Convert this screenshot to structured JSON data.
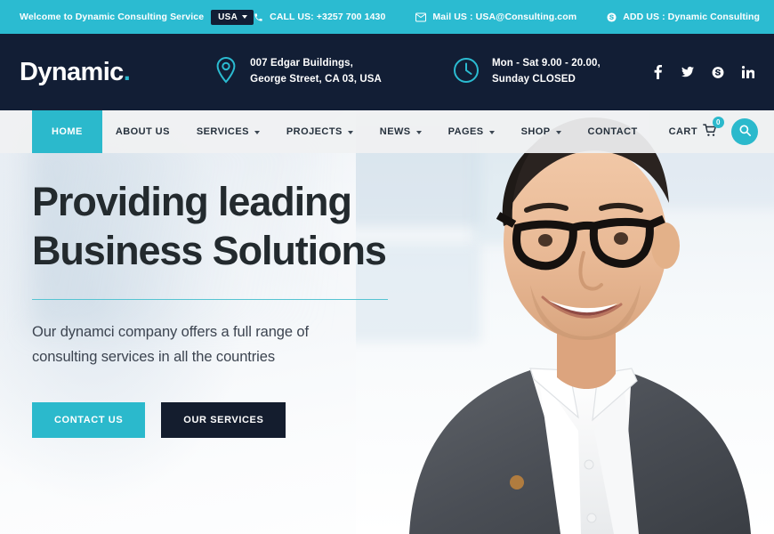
{
  "topbar": {
    "welcome": "Welcome to Dynamic Consulting Service",
    "country": "USA",
    "call": "CALL US: +3257 700 1430",
    "mail": "Mail US : USA@Consulting.com",
    "address": "ADD US : Dynamic Consulting",
    "icons": {
      "phone": "phone-icon",
      "envelope": "envelope-icon",
      "skype": "skype-icon",
      "caret": "chevron-down-icon"
    },
    "bg_color": "#2bbbd1"
  },
  "header": {
    "logo_text": "Dynamic",
    "logo_dot": ".",
    "address_line1": "007 Edgar Buildings,",
    "address_line2": "George Street, CA 03, USA",
    "hours_line1": "Mon - Sat 9.00 - 20.00,",
    "hours_line2": "Sunday CLOSED",
    "bg_color": "#121e35",
    "social": [
      {
        "name": "facebook",
        "label": "f"
      },
      {
        "name": "twitter",
        "label": "t"
      },
      {
        "name": "skype",
        "label": "s"
      },
      {
        "name": "linkedin",
        "label": "in"
      }
    ]
  },
  "nav": {
    "items": [
      {
        "label": "HOME",
        "active": true,
        "has_dropdown": false
      },
      {
        "label": "ABOUT US",
        "active": false,
        "has_dropdown": false
      },
      {
        "label": "SERVICES",
        "active": false,
        "has_dropdown": true
      },
      {
        "label": "PROJECTS",
        "active": false,
        "has_dropdown": true
      },
      {
        "label": "NEWS",
        "active": false,
        "has_dropdown": true
      },
      {
        "label": "PAGES",
        "active": false,
        "has_dropdown": true
      },
      {
        "label": "SHOP",
        "active": false,
        "has_dropdown": true
      },
      {
        "label": "CONTACT",
        "active": false,
        "has_dropdown": false
      }
    ],
    "cart_label": "CART",
    "cart_count": "0",
    "accent_color": "#2bb9cc"
  },
  "hero": {
    "title_line1": "Providing leading",
    "title_line2": "Business Solutions",
    "sub_line1": "Our dynamci company offers a full range of",
    "sub_line2": "consulting services in all the countries",
    "btn_primary": "CONTACT US",
    "btn_secondary": "OUR SERVICES"
  }
}
